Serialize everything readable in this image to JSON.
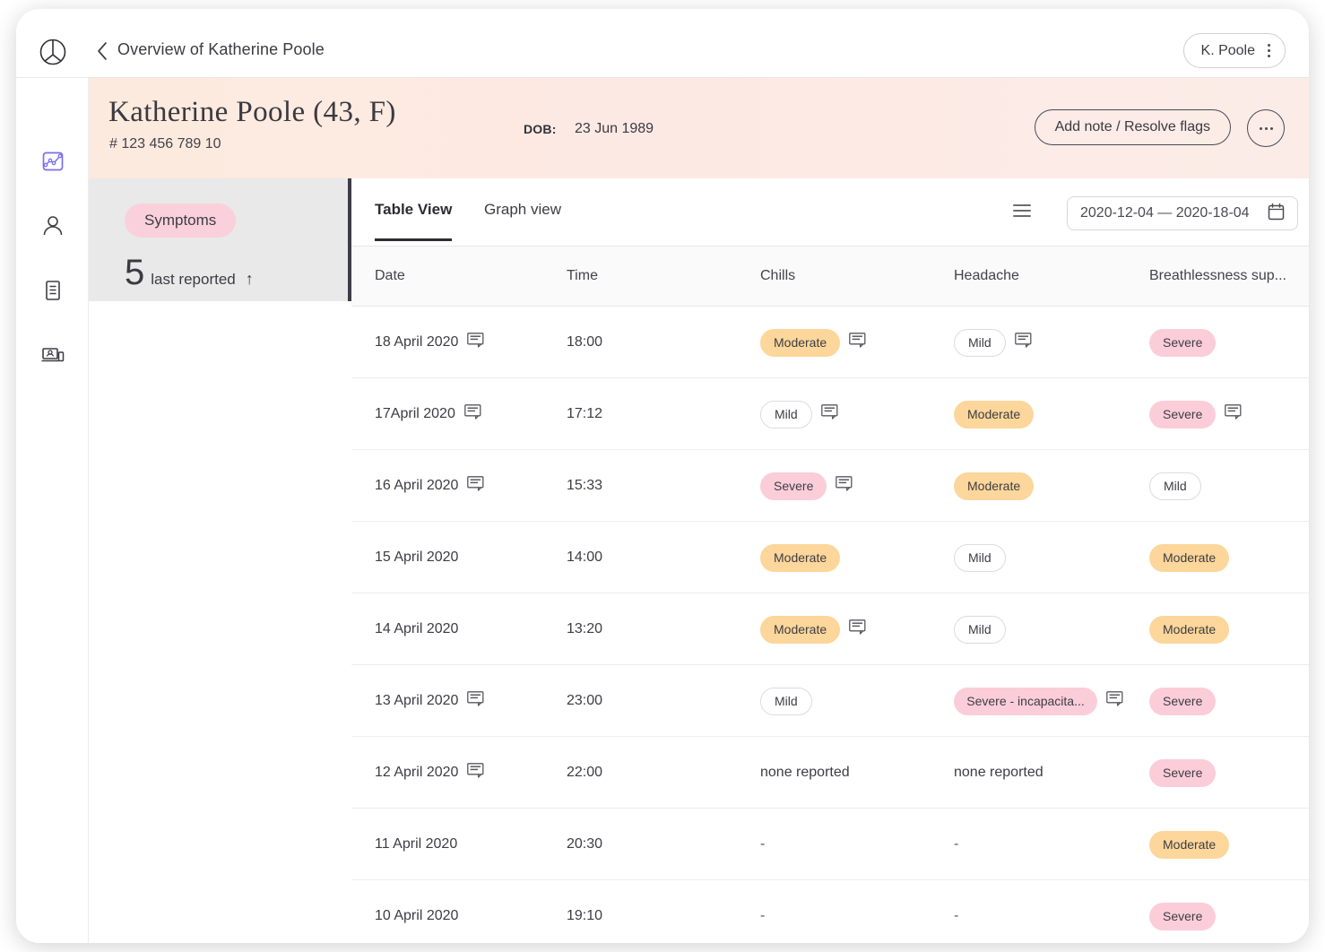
{
  "topbar": {
    "logo_icon": "peace-circle-logo",
    "back_icon": "chevron-left-icon",
    "title": "Overview of Katherine Poole",
    "user_chip": {
      "label": "K. Poole",
      "icon": "kebab-vertical-icon"
    }
  },
  "banner": {
    "patient_name": "Katherine Poole (43,  F)",
    "patient_id": "# 123 456 789 10",
    "dob_label": "DOB:",
    "dob_value": "23 Jun 1989",
    "add_note_button": "Add note / Resolve flags",
    "more_button_icon": "ellipsis-icon"
  },
  "sidebar": {
    "items": [
      {
        "name": "sidebar-item-analytics",
        "icon": "chart-line-icon",
        "active": true
      },
      {
        "name": "sidebar-item-patient",
        "icon": "person-icon",
        "active": false
      },
      {
        "name": "sidebar-item-records",
        "icon": "document-icon",
        "active": false
      },
      {
        "name": "sidebar-item-telehealth",
        "icon": "devices-icon",
        "active": false
      }
    ],
    "active_color": "#7b6ef0"
  },
  "stat_panel": {
    "pill_label": "Symptoms",
    "pill_color": "#fad0dc",
    "count": "5",
    "count_caption": "last reported",
    "trend_icon": "arrow-up-icon",
    "trend_glyph": "↑"
  },
  "tabs": [
    {
      "label": "Table View",
      "active": true
    },
    {
      "label": "Graph view",
      "active": false
    }
  ],
  "toolbar": {
    "list_icon": "hamburger-icon",
    "date_range": "2020-12-04 — 2020-18-04",
    "calendar_icon": "calendar-icon"
  },
  "table": {
    "columns": [
      "Date",
      "Time",
      "Chills",
      "Headache",
      "Breathlessness sup..."
    ],
    "rows": [
      {
        "date": "18 April 2020",
        "date_note": true,
        "time": "18:00",
        "chills": {
          "text": "Moderate",
          "level": "moderate",
          "note": true
        },
        "headache": {
          "text": "Mild",
          "level": "mild",
          "note": true
        },
        "breathlessness": {
          "text": "Severe",
          "level": "severe",
          "note": false
        }
      },
      {
        "date": "17April 2020",
        "date_note": true,
        "time": "17:12",
        "chills": {
          "text": "Mild",
          "level": "mild",
          "note": true
        },
        "headache": {
          "text": "Moderate",
          "level": "moderate",
          "note": false
        },
        "breathlessness": {
          "text": "Severe",
          "level": "severe",
          "note": true
        }
      },
      {
        "date": "16 April 2020",
        "date_note": true,
        "time": "15:33",
        "chills": {
          "text": "Severe",
          "level": "severe",
          "note": true
        },
        "headache": {
          "text": "Moderate",
          "level": "moderate",
          "note": false
        },
        "breathlessness": {
          "text": "Mild",
          "level": "mild",
          "note": false
        }
      },
      {
        "date": "15 April 2020",
        "date_note": false,
        "time": "14:00",
        "chills": {
          "text": "Moderate",
          "level": "moderate",
          "note": false
        },
        "headache": {
          "text": "Mild",
          "level": "mild",
          "note": false
        },
        "breathlessness": {
          "text": "Moderate",
          "level": "moderate",
          "note": false
        }
      },
      {
        "date": "14 April 2020",
        "date_note": false,
        "time": "13:20",
        "chills": {
          "text": "Moderate",
          "level": "moderate",
          "note": true
        },
        "headache": {
          "text": "Mild",
          "level": "mild",
          "note": false
        },
        "breathlessness": {
          "text": "Moderate",
          "level": "moderate",
          "note": false
        }
      },
      {
        "date": "13 April 2020",
        "date_note": true,
        "time": "23:00",
        "chills": {
          "text": "Mild",
          "level": "mild",
          "note": false
        },
        "headache": {
          "text": "Severe - incapacita...",
          "level": "severe",
          "note": true
        },
        "breathlessness": {
          "text": "Severe",
          "level": "severe",
          "note": false
        }
      },
      {
        "date": "12 April 2020",
        "date_note": true,
        "time": "22:00",
        "chills": {
          "text": "none reported",
          "level": "plain",
          "note": false
        },
        "headache": {
          "text": "none reported",
          "level": "plain",
          "note": false
        },
        "breathlessness": {
          "text": "Severe",
          "level": "severe",
          "note": false
        }
      },
      {
        "date": "11 April 2020",
        "date_note": false,
        "time": "20:30",
        "chills": {
          "text": "-",
          "level": "plain",
          "note": false
        },
        "headache": {
          "text": "-",
          "level": "plain",
          "note": false
        },
        "breathlessness": {
          "text": "Moderate",
          "level": "moderate",
          "note": false
        }
      },
      {
        "date": "10 April 2020",
        "date_note": false,
        "time": "19:10",
        "chills": {
          "text": "-",
          "level": "plain",
          "note": false
        },
        "headache": {
          "text": "-",
          "level": "plain",
          "note": false
        },
        "breathlessness": {
          "text": "Severe",
          "level": "severe",
          "note": false
        }
      }
    ]
  },
  "colors": {
    "mild_bg": "#ffffff",
    "moderate_bg": "#fcd69a",
    "severe_bg": "#fbcdd9",
    "banner_bg": "#fdeade",
    "accent": "#7b6ef0"
  }
}
